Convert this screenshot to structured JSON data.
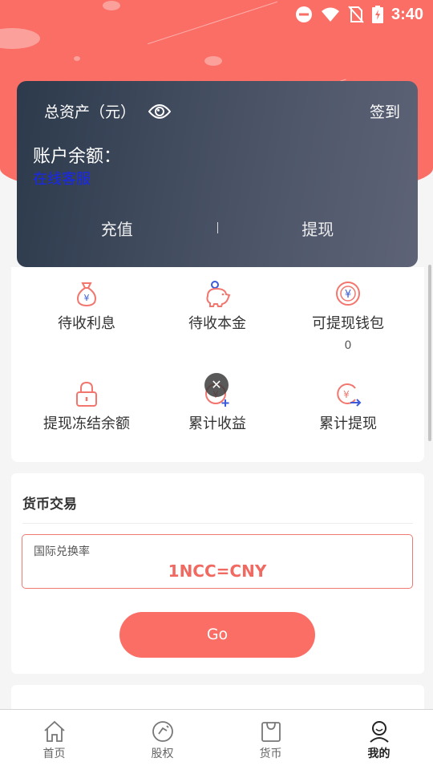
{
  "status_bar": {
    "time": "3:40",
    "icons": [
      "do-not-disturb-icon",
      "wifi-icon",
      "no-sim-icon",
      "battery-charging-icon"
    ]
  },
  "asset_card": {
    "title": "总资产（元）",
    "checkin_label": "签到",
    "balance_label": "账户余额：",
    "service_link": "在线客服",
    "recharge_label": "充值",
    "withdraw_label": "提现"
  },
  "stats": [
    {
      "label": "待收利息",
      "icon": "money-bag-icon"
    },
    {
      "label": "待收本金",
      "icon": "piggy-bank-icon"
    },
    {
      "label": "可提现钱包",
      "icon": "yuan-coin-icon",
      "value": "0"
    },
    {
      "label": "提现冻结余额",
      "icon": "lock-icon"
    },
    {
      "label": "累计收益",
      "icon": "coin-plus-icon"
    },
    {
      "label": "累计提现",
      "icon": "coin-arrow-icon"
    }
  ],
  "overlay_badge": "✕",
  "trade": {
    "title": "货币交易",
    "rate_label": "国际兑换率",
    "rate_value": "1NCC=CNY",
    "go_label": "Go"
  },
  "tabs": [
    {
      "label": "首页",
      "icon": "home-icon"
    },
    {
      "label": "股权",
      "icon": "equity-icon"
    },
    {
      "label": "货币",
      "icon": "bag-icon"
    },
    {
      "label": "我的",
      "icon": "user-icon",
      "active": true
    }
  ],
  "colors": {
    "accent": "#fa6e66",
    "card_dark": "#2c3a4c",
    "link": "#1726f0",
    "icon_coral": "#f2766e",
    "icon_blue": "#3b5bdb"
  }
}
